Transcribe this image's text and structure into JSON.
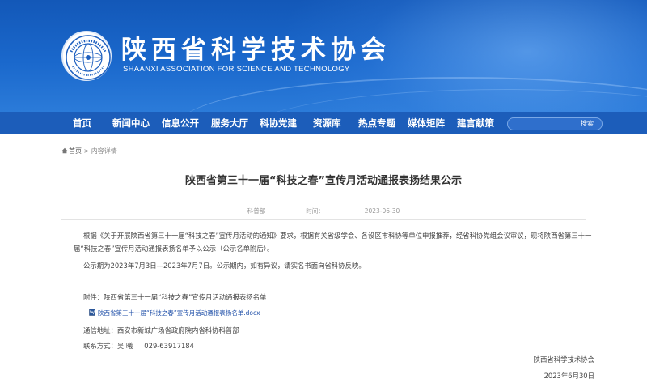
{
  "header": {
    "site_name": "陕西省科学技术协会",
    "site_name_en": "SHAANXI ASSOCIATION FOR SCIENCE AND TECHNOLOGY",
    "emblem_text": "中国科学技术协会"
  },
  "nav": {
    "items": [
      "首页",
      "新闻中心",
      "信息公开",
      "服务大厅",
      "科协党建",
      "资源库",
      "热点专题",
      "媒体矩阵",
      "建言献策"
    ],
    "search_label": "搜索"
  },
  "breadcrumb": {
    "home": "首页",
    "separator": ">",
    "current": "内容详情"
  },
  "article": {
    "title": "陕西省第三十一届“科技之春”宣传月活动通报表扬结果公示",
    "source": "科普部",
    "time_label": "时间：",
    "time": "2023-06-30",
    "paragraph1": "根据《关于开展陕西省第三十一届“科技之春”宣传月活动的通知》要求，根据有关省级学会、各设区市科协等单位申报推荐，经省科协党组会议审议，现将陕西省第三十一届“科技之春”宣传月活动通报表扬名单予以公示（公示名单附后）。",
    "paragraph2": "公示期为2023年7月3日—2023年7月7日。公示期内，如有异议，请实名书面向省科协反映。",
    "attachment": "附件：陕西省第三十一届“科技之春”宣传月活动通报表扬名单",
    "file_name": "陕西省第三十一届“科技之春”宣传月活动通报表扬名单.docx",
    "address": "通信地址：西安市新城广场省政府院内省科协科普部",
    "contact_label": "联系方式：吴  曦",
    "contact_phone": "029-63917184",
    "signature_org": "陕西省科学技术协会",
    "signature_date": "2023年6月30日"
  },
  "colors": {
    "banner": "#1a68cc",
    "nav": "#1c5dba",
    "link": "#1f4fa8"
  }
}
